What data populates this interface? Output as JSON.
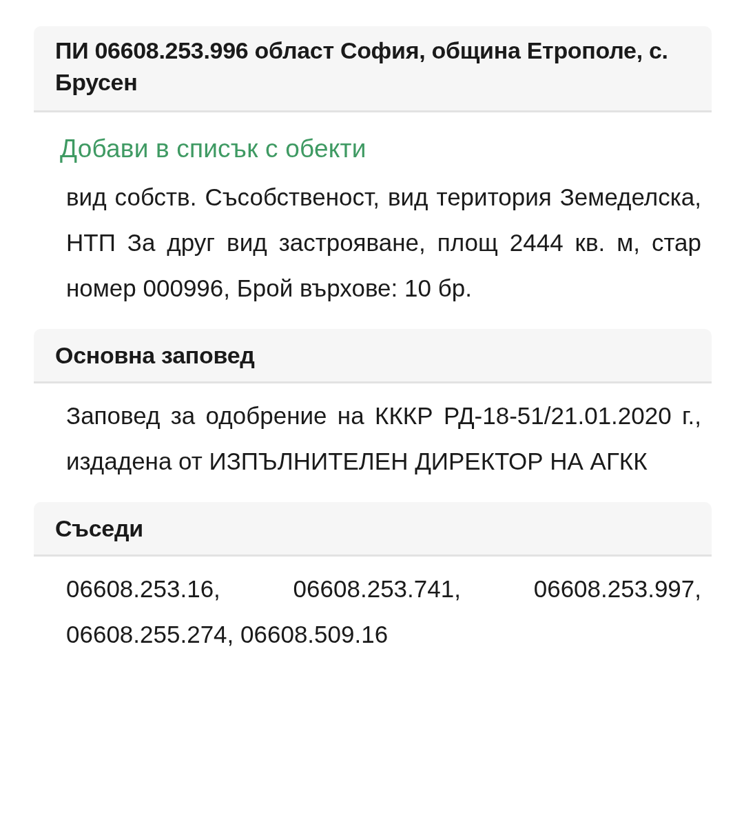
{
  "header": {
    "title": "ПИ 06608.253.996 област София, община Етрополе, с. Брусен"
  },
  "add_link": "Добави в списък с обекти",
  "description": "вид собств. Съсобственост, вид територия Земеделска, НТП За друг вид застрояване, площ 2444 кв. м, стар номер 000996, Брой върхове: 10 бр.",
  "sections": [
    {
      "heading": "Основна заповед",
      "text": "Заповед за одобрение на КККР РД-18-51/21.01.2020 г., издадена от ИЗПЪЛНИТЕЛЕН ДИРЕКТОР НА АГКК"
    },
    {
      "heading": "Съседи",
      "text": "06608.253.16, 06608.253.741, 06608.253.997, 06608.255.274, 06608.509.16"
    }
  ]
}
